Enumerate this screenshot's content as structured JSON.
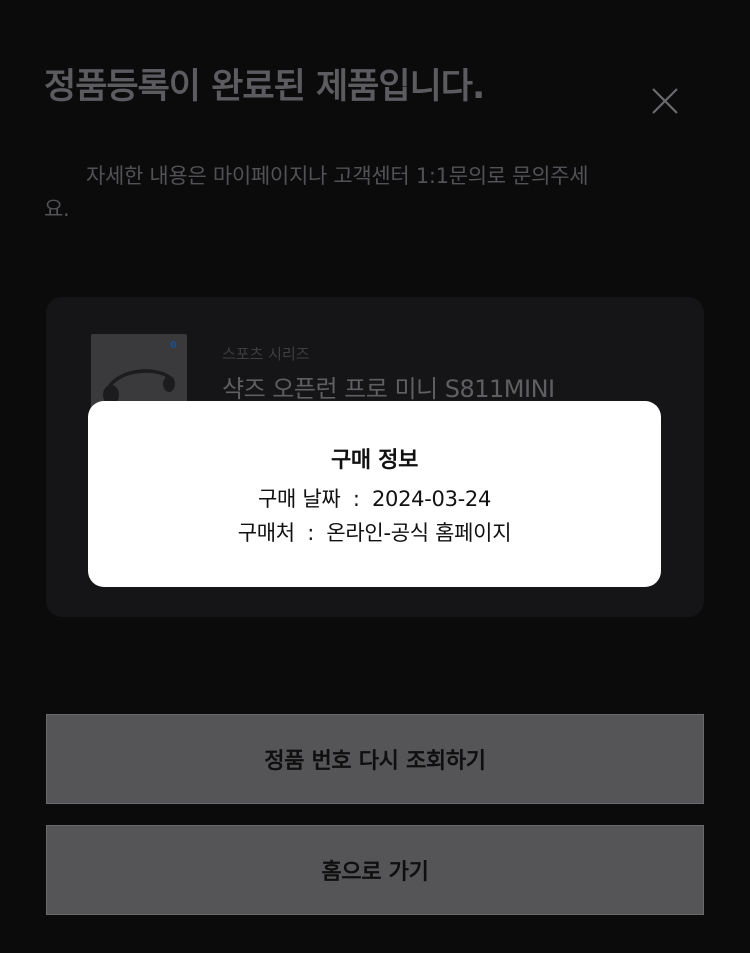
{
  "page": {
    "title": "정품등록이 완료된 제품입니다.",
    "description": "자세한 내용은 마이페이지나 고객센터 1:1문의로 문의주세요."
  },
  "product": {
    "series": "스포츠 시리즈",
    "name": "샥즈 오픈런 프로 미니 S811MINI",
    "thumb_badge": "0"
  },
  "modal": {
    "title": "구매 정보",
    "date_label": "구매 날짜",
    "date_value": "2024-03-24",
    "place_label": "구매처",
    "place_value": "온라인-공식 홈페이지",
    "separator": ":"
  },
  "buttons": {
    "recheck_label": "정품 번호 다시 조회하기",
    "home_label": "홈으로 가기"
  },
  "icons": {
    "close": "close-icon"
  }
}
